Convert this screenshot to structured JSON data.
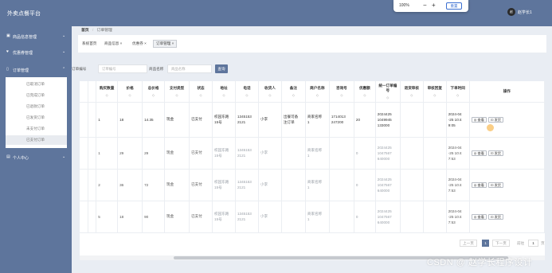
{
  "header": {
    "title": "外卖点餐平台",
    "user_name": "赵学长1",
    "avatar_text": "赵"
  },
  "zoom": {
    "percent": "100%",
    "minus": "−",
    "plus": "+",
    "reset_label": "重置"
  },
  "sidebar": {
    "menus": [
      {
        "label": "商品信息管理",
        "icon": "monitor-icon"
      },
      {
        "label": "优惠券管理",
        "icon": "heart-icon"
      },
      {
        "label": "订单管理",
        "icon": "tablet-icon"
      }
    ],
    "submenu": [
      "已取消订单",
      "已完成订单",
      "已退款订单",
      "已发货订单",
      "未支付订单",
      "已支付订单"
    ],
    "active_sub": 5,
    "personal": "个人中心"
  },
  "breadcrumb": {
    "home": "首页",
    "sep": "/",
    "current": "订单管理"
  },
  "tabs": [
    {
      "label": "系统首页",
      "close": false
    },
    {
      "label": "商品信息",
      "close": true
    },
    {
      "label": "优惠券",
      "close": true
    },
    {
      "label": "订单管理",
      "close": true
    }
  ],
  "search": {
    "order_no_label": "订单编号",
    "order_no_placeholder": "订单编号",
    "product_label": "商品名称",
    "product_placeholder": "商品名称",
    "button": "查询"
  },
  "table": {
    "columns": [
      "",
      "",
      "购买数量",
      "价格",
      "总价格",
      "支付类型",
      "状态",
      "地址",
      "电话",
      "收货人",
      "备注",
      "商户名称",
      "咨询号",
      "优惠额",
      "统一订单编号",
      "退货审核",
      "审核回复",
      "下单时间",
      "操作"
    ],
    "sort_mark": "◇",
    "rows": [
      [
        "",
        "",
        "1",
        "18",
        "14.35",
        "现金",
        "已支付",
        [
          "校园东路",
          "15号"
        ],
        [
          "1345153",
          "2121"
        ],
        "小李",
        [
          "出餐可备",
          "注订单"
        ],
        [
          "商家名称",
          "1"
        ],
        [
          "1714013",
          "247200"
        ],
        "20",
        [
          "2024425",
          "1049945",
          "133000"
        ],
        "",
        "",
        [
          "2024-04",
          "-25 10:4",
          "9:05"
        ]
      ],
      [
        "",
        "",
        "1",
        "29",
        "29",
        "现金",
        "已支付",
        [
          "校园东路",
          "15号"
        ],
        [
          "1345153",
          "2121"
        ],
        "小李",
        "",
        [
          "商家名称",
          "1"
        ],
        "",
        "0",
        [
          "2024425",
          "1047567",
          "640000"
        ],
        "",
        "",
        [
          "2024-04",
          "-25 10:4",
          "7:53"
        ]
      ],
      [
        "",
        "",
        "2",
        "36",
        "72",
        "现金",
        "已支付",
        [
          "校园东路",
          "15号"
        ],
        [
          "1345153",
          "2121"
        ],
        "小李",
        "",
        [
          "商家名称",
          "1"
        ],
        "",
        "0",
        [
          "2024425",
          "1047567",
          "640000"
        ],
        "",
        "",
        [
          "2024-04",
          "-25 10:4",
          "7:53"
        ]
      ],
      [
        "",
        "",
        "5",
        "18",
        "90",
        "现金",
        "已支付",
        [
          "校园东路",
          "15号"
        ],
        [
          "1345153",
          "2121"
        ],
        "小李",
        "",
        [
          "商家名称",
          "1"
        ],
        "",
        "0",
        [
          "2024425",
          "1047567",
          "640000"
        ],
        "",
        "",
        [
          "2024-04",
          "-25 10:4",
          "7:53"
        ]
      ]
    ],
    "actions": [
      "◎ 查看",
      "⊡ 发货"
    ]
  },
  "pager": {
    "prev": "上一页",
    "current": "1",
    "next": "下一页",
    "goto": "前往",
    "page_input": "1",
    "page_unit": "页"
  },
  "watermark": "CSDN @ 赵学长程序设计"
}
